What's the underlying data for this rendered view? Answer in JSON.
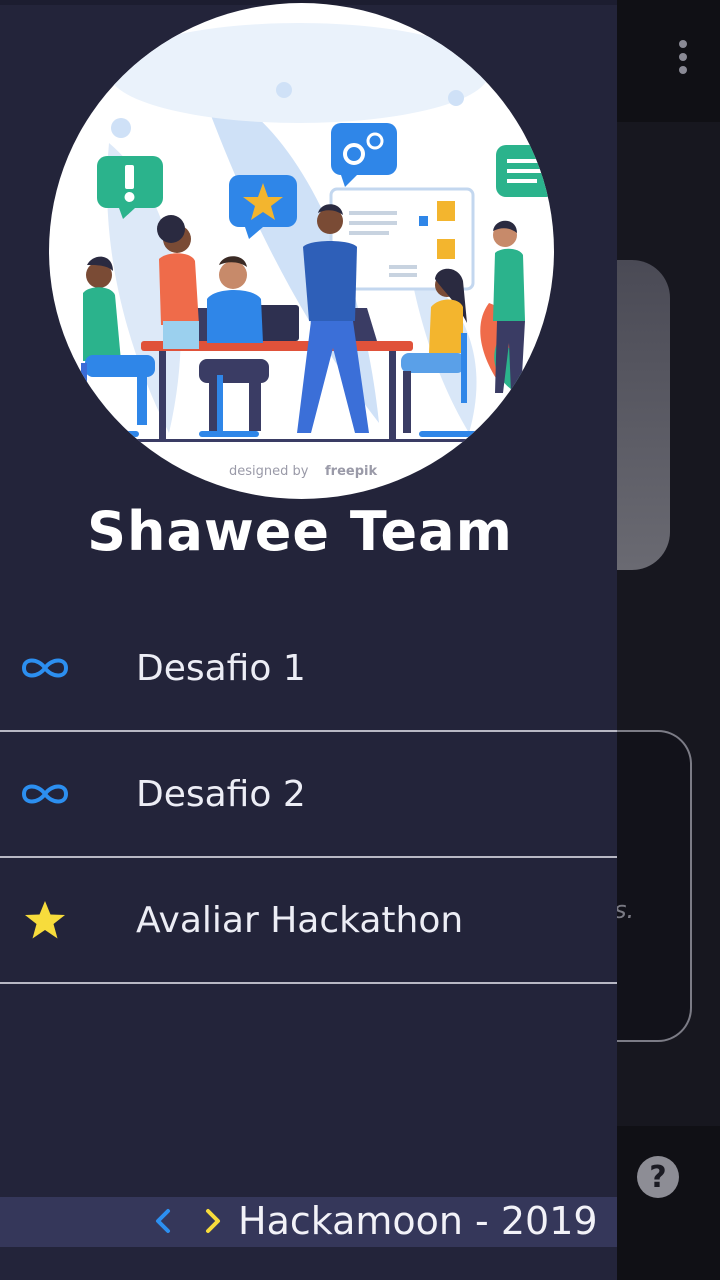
{
  "drawer": {
    "team_name": "Shawee Team",
    "hero_credit": "designed by",
    "hero_credit_brand": "freepik",
    "menu": [
      {
        "label": "Desafio 1",
        "icon": "infinity-icon"
      },
      {
        "label": "Desafio 2",
        "icon": "infinity-icon"
      },
      {
        "label": "Avaliar Hackathon",
        "icon": "star-icon"
      }
    ],
    "footer": {
      "label": "Hackamoon - 2019",
      "prev_icon": "chevron-left-icon",
      "next_icon": "chevron-right-icon"
    }
  },
  "background": {
    "card_text": "s.",
    "help_label": "?"
  },
  "colors": {
    "drawer_bg": "#23243a",
    "accent_blue": "#2c8ff0",
    "accent_yellow": "#f7dc3c",
    "footer_bg": "#35375a"
  }
}
